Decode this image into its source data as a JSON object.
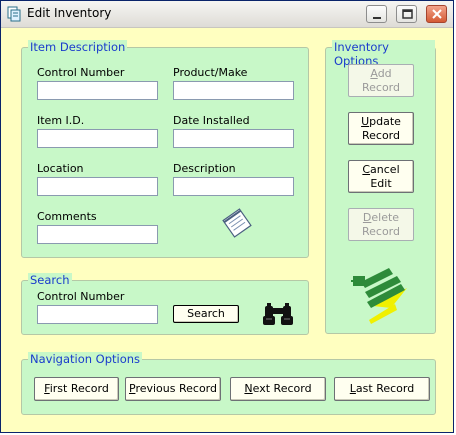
{
  "window": {
    "title": "Edit Inventory"
  },
  "item_description": {
    "legend": "Item Description",
    "fields": {
      "control_number": {
        "label": "Control Number",
        "value": ""
      },
      "product_make": {
        "label": "Product/Make",
        "value": ""
      },
      "item_id": {
        "label": "Item I.D.",
        "value": ""
      },
      "date_installed": {
        "label": "Date Installed",
        "value": ""
      },
      "location": {
        "label": "Location",
        "value": ""
      },
      "description": {
        "label": "Description",
        "value": ""
      },
      "comments": {
        "label": "Comments",
        "value": ""
      }
    }
  },
  "inventory_options": {
    "legend": "Inventory Options",
    "add": {
      "ul": "A",
      "l1": "dd",
      "l2": "Record"
    },
    "update": {
      "ul": "U",
      "l1": "pdate",
      "l2": "Record"
    },
    "cancel": {
      "ul": "C",
      "l1": "ancel",
      "l2": "Edit"
    },
    "delete": {
      "ul": "D",
      "l1": "elete",
      "l2": "Record"
    }
  },
  "search": {
    "legend": "Search",
    "label": "Control Number",
    "value": "",
    "button": "Search"
  },
  "navigation": {
    "legend": "Navigation Options",
    "first": {
      "ul": "F",
      "rest": "irst Record"
    },
    "previous": {
      "ul": "P",
      "rest": "revious Record"
    },
    "next": {
      "ul": "N",
      "rest": "ext Record"
    },
    "last": {
      "ul": "L",
      "rest": "ast Record"
    }
  }
}
